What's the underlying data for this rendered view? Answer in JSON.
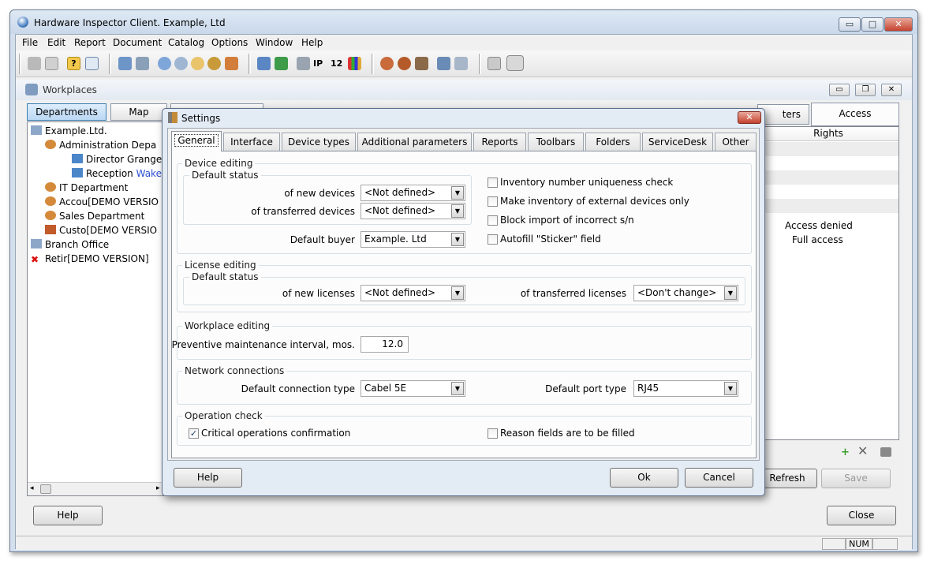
{
  "window": {
    "title": "Hardware Inspector Client. Example, Ltd",
    "btn_min": "▭",
    "btn_max": "□",
    "btn_close": "✕"
  },
  "menu": [
    "File",
    "Edit",
    "Report",
    "Document",
    "Catalog",
    "Options",
    "Window",
    "Help"
  ],
  "mdi": {
    "title": "Workplaces"
  },
  "left_panel": {
    "tab_departments": "Departments",
    "tab_map": "Map",
    "tree": [
      {
        "label": "Example.Ltd.",
        "suffix": ""
      },
      {
        "label": "Administration Depa",
        "suffix": ""
      },
      {
        "label": "Director",
        "suffix": "Granger,"
      },
      {
        "label": "Reception",
        "suffix": "Wakel"
      },
      {
        "label": "IT Department",
        "suffix": ""
      },
      {
        "label": "Accou[DEMO VERSIO",
        "suffix": ""
      },
      {
        "label": "Sales Department",
        "suffix": ""
      },
      {
        "label": "Custo[DEMO VERSIO",
        "suffix": ""
      },
      {
        "label": "Branch Office",
        "suffix": ""
      },
      {
        "label": "Retir[DEMO VERSION]",
        "suffix": ""
      }
    ],
    "help_button": "Help"
  },
  "right_panel": {
    "tab_partial": "ters",
    "tab_access": "Access",
    "column_rights": "Rights",
    "rows": [
      "Access denied",
      "Full access"
    ],
    "refresh_button": "Refresh",
    "save_button": "Save",
    "close_button": "Close"
  },
  "status": {
    "num": "NUM"
  },
  "settings": {
    "title": "Settings",
    "tabs": [
      "General",
      "Interface",
      "Device types",
      "Additional parameters",
      "Reports",
      "Toolbars",
      "Folders",
      "ServiceDesk",
      "Other"
    ],
    "device_editing": {
      "title": "Device editing",
      "default_status": "Default status",
      "new_devices_label": "of new devices",
      "new_devices_value": "<Not defined>",
      "transferred_devices_label": "of transferred devices",
      "transferred_devices_value": "<Not defined>",
      "default_buyer_label": "Default buyer",
      "default_buyer_value": "Example. Ltd",
      "chk_inventory_unique": "Inventory number uniqueness check",
      "chk_external_only": "Make inventory of external devices only",
      "chk_block_import": "Block import of incorrect s/n",
      "chk_autofill_sticker": "Autofill \"Sticker\" field"
    },
    "license_editing": {
      "title": "License editing",
      "default_status": "Default status",
      "new_licenses_label": "of new licenses",
      "new_licenses_value": "<Not defined>",
      "transferred_licenses_label": "of transferred licenses",
      "transferred_licenses_value": "<Don't change>"
    },
    "workplace_editing": {
      "title": "Workplace editing",
      "interval_label": "Preventive maintenance interval, mos.",
      "interval_value": "12.0"
    },
    "network": {
      "title": "Network connections",
      "conn_type_label": "Default connection type",
      "conn_type_value": "Cabel 5E",
      "port_type_label": "Default port type",
      "port_type_value": "RJ45"
    },
    "operation_check": {
      "title": "Operation check",
      "critical_confirm": "Critical operations confirmation",
      "critical_confirm_checked": true,
      "reason_fields": "Reason fields are to be filled",
      "reason_fields_checked": false
    },
    "help_button": "Help",
    "ok_button": "Ok",
    "cancel_button": "Cancel"
  }
}
